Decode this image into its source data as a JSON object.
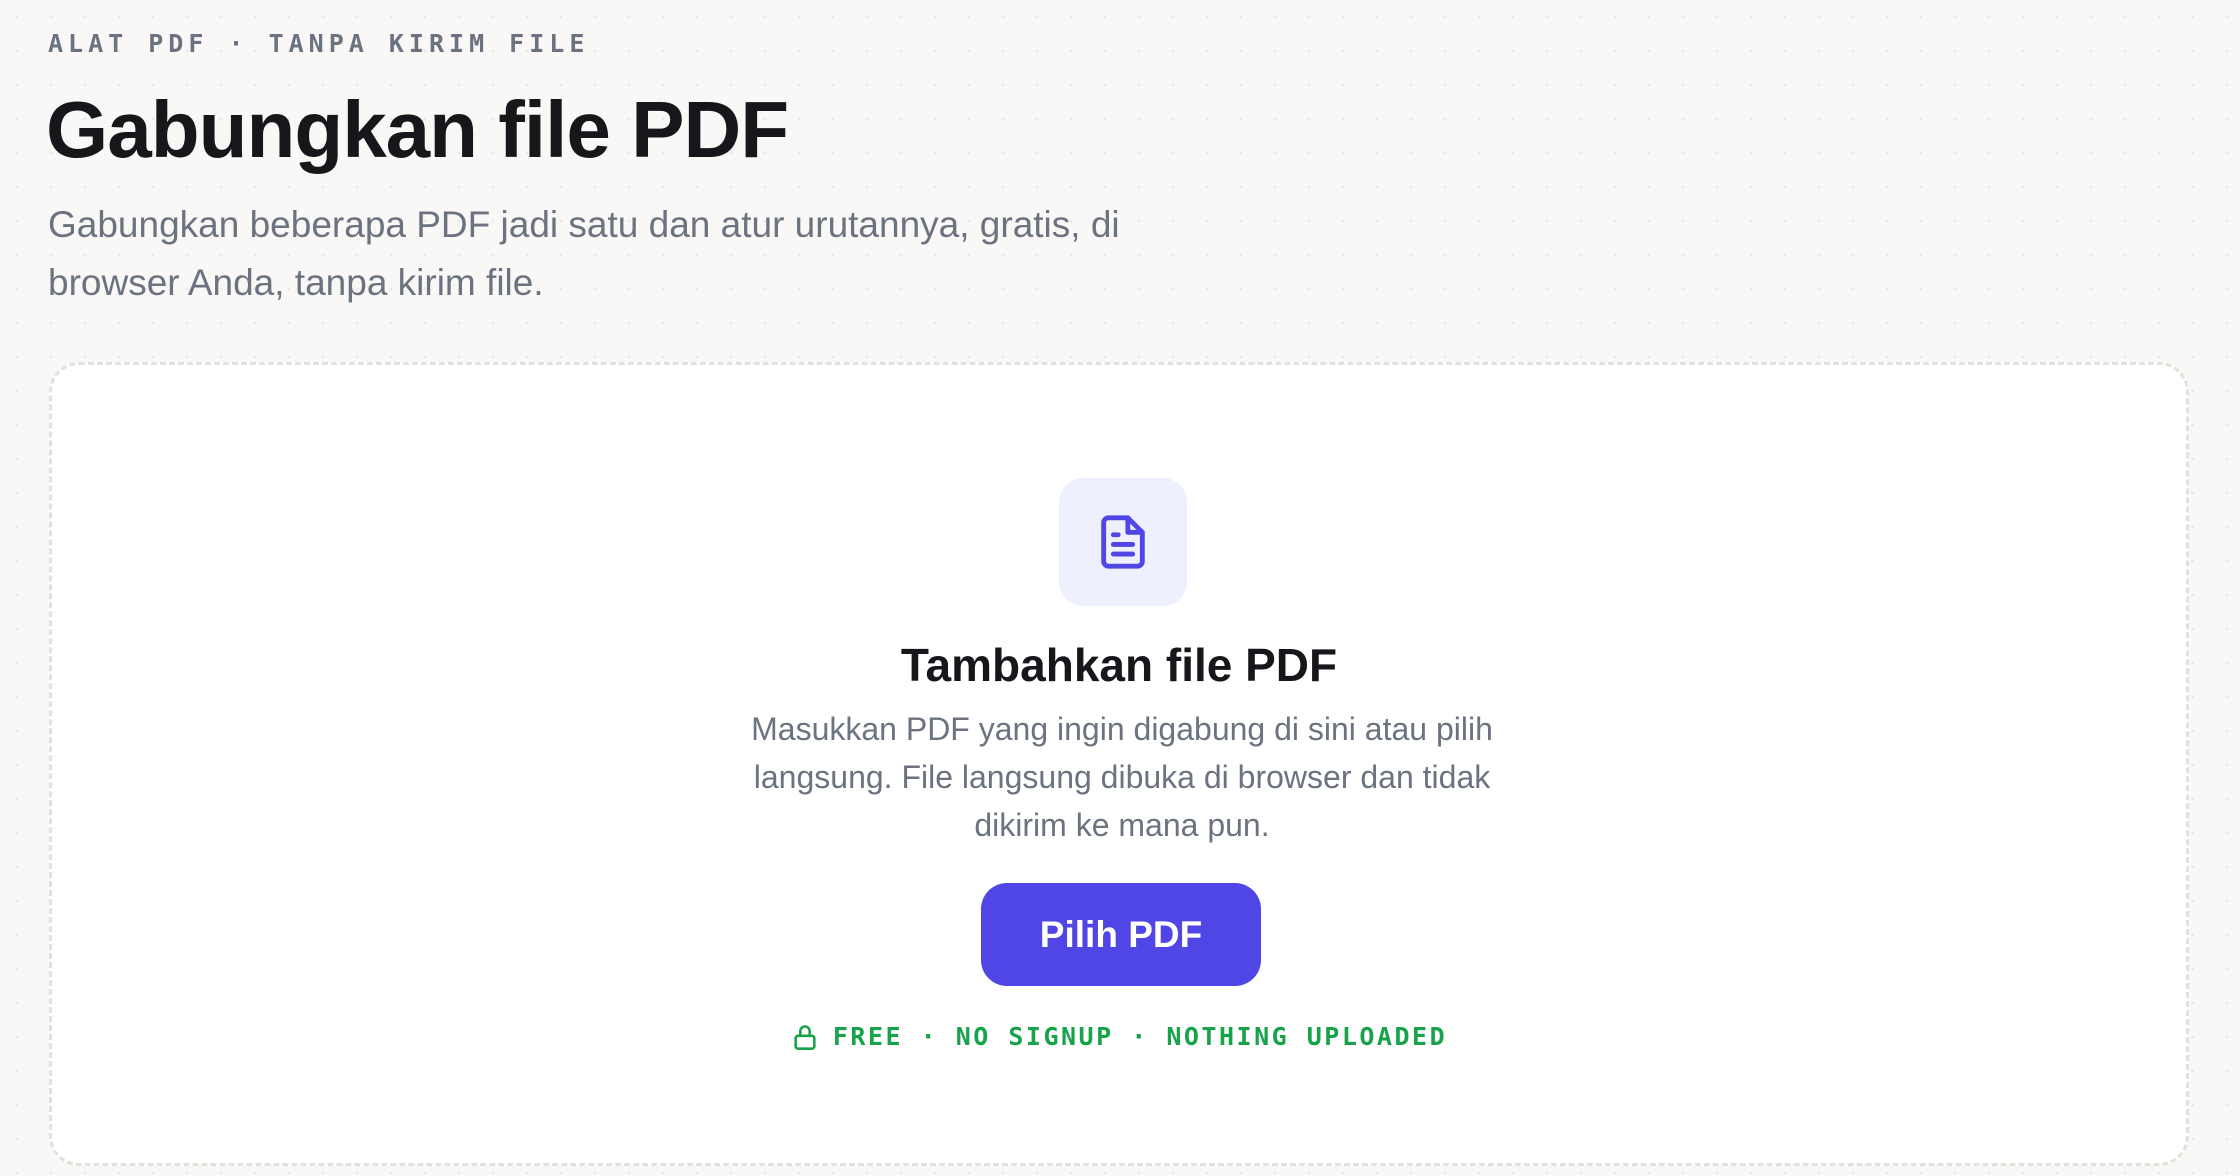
{
  "header": {
    "eyebrow": "ALAT PDF · TANPA KIRIM FILE",
    "title": "Gabungkan file PDF",
    "subtitle": "Gabungkan beberapa PDF jadi satu dan atur urutannya, gratis, di browser Anda, tanpa kirim file."
  },
  "dropzone": {
    "icon": "file-text-icon",
    "heading": "Tambahkan file PDF",
    "description": "Masukkan PDF yang ingin digabung di sini atau pilih langsung. File langsung dibuka di browser dan tidak dikirim ke mana pun.",
    "button_label": "Pilih PDF",
    "badge_icon": "lock-icon",
    "badge_text": "FREE · NO SIGNUP · NOTHING UPLOADED"
  },
  "colors": {
    "accent": "#4f46e5",
    "accent_tint": "#eef0fd",
    "success": "#16a34a",
    "text_primary": "#16171b",
    "text_muted": "#6b7280",
    "page_background": "#f9f8f6"
  }
}
